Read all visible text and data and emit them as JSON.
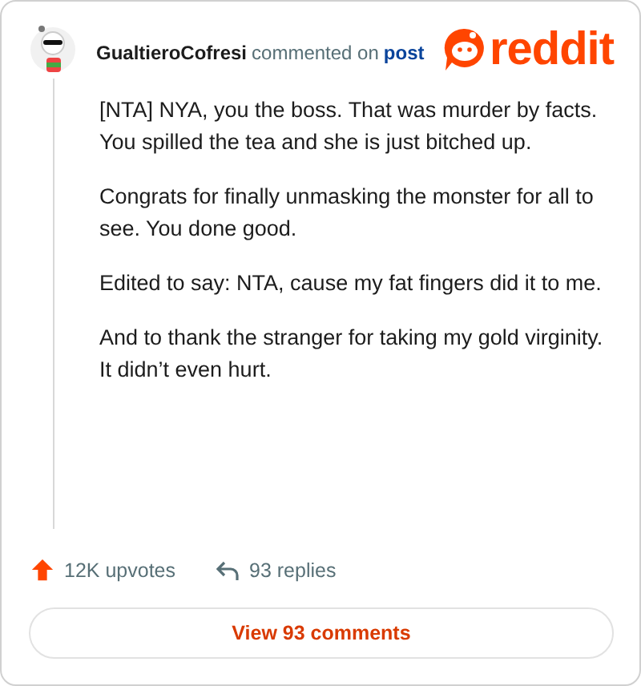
{
  "header": {
    "username": "GualtieroCofresi",
    "action": "commented on",
    "link": "post",
    "brand": "reddit"
  },
  "paragraphs": [
    "[NTA] NYA, you the boss. That was murder by facts. You spilled the tea and she is just bitched up.",
    "Congrats for finally unmasking the monster for all to see. You done good.",
    "Edited to say: NTA, cause my fat fingers did it to me.",
    "And to thank the stranger for taking my gold virginity. It didn’t even hurt."
  ],
  "stats": {
    "upvotes": "12K upvotes",
    "replies": "93 replies"
  },
  "button": "View 93 comments"
}
